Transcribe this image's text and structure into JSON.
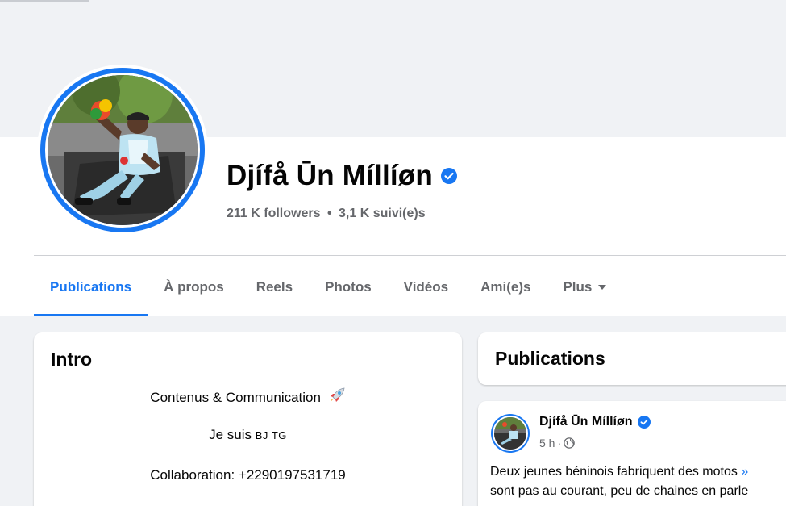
{
  "profile": {
    "name": "Djífå Ūn Míllíøn",
    "followers": "211 K followers",
    "separator": "•",
    "following": "3,1 K suivi(e)s"
  },
  "tabs": [
    {
      "label": "Publications",
      "active": true
    },
    {
      "label": "À propos"
    },
    {
      "label": "Reels"
    },
    {
      "label": "Photos"
    },
    {
      "label": "Vidéos"
    },
    {
      "label": "Ami(e)s"
    },
    {
      "label": "Plus"
    }
  ],
  "intro": {
    "title": "Intro",
    "bio_line": "Contenus & Communication",
    "bio_emoji": "rocket-icon",
    "location_prefix": "Je suis",
    "location_codes": "BJ TG",
    "collab": "Collaboration: +2290197531719"
  },
  "publications": {
    "title": "Publications"
  },
  "post": {
    "author": "Djífå Ūn Míllíøn",
    "time": "5 h",
    "meta_separator": "·",
    "visibility_icon": "globe-icon",
    "text_line1": "Deux jeunes béninois fabriquent des motos",
    "text_line1_more": "»",
    "text_line2": "sont pas au courant, peu de chaines en parle"
  },
  "colors": {
    "accent": "#1877f2",
    "secondary_text": "#65676b",
    "background": "#f0f2f5"
  }
}
